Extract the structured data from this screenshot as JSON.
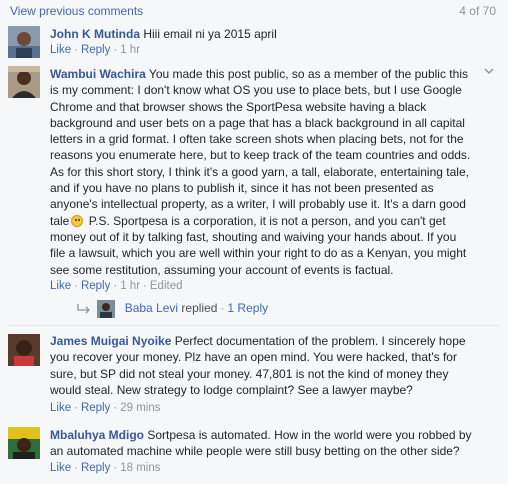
{
  "header": {
    "view_previous": "View previous comments",
    "count": "4 of 70"
  },
  "comments": [
    {
      "author": "John K Mutinda",
      "text": "Hiii email ni ya 2015 april",
      "like": "Like",
      "reply": "Reply",
      "time": "1 hr"
    },
    {
      "author": "Wambui Wachira",
      "lines": [
        " You made this post public, so as a member of the public this",
        "is my comment: I don't know what OS you use to place bets, but I use Google",
        "Chrome and that browser shows the SportPesa website having a black",
        "background and user bets on a page that has a black background in all capital",
        "letters in a grid format. I often take screen shots when placing bets, not for the",
        "reasons you enumerate here, but to keep track of the team countries and odds.",
        "As for this short story, I think it's a good yarn, a tall, elaborate, entertaining tale,",
        "and if you have no plans to publish it, since it has not been presented as",
        "anyone's intellectual property, as a writer, I will probably use it. It's a darn good",
        "tale",
        " P.S. Sportpesa is a corporation, it is not a person, and you can't get",
        "money out of it by talking fast, shouting and waiving your hands about. If you",
        "file a lawsuit, which you are well within your right to do as a Kenyan, you might",
        "see some restitution, assuming your account of events is factual."
      ],
      "like": "Like",
      "reply": "Reply",
      "time": "1 hr",
      "edited": "Edited",
      "reply_summary": {
        "name": "Baba Levi",
        "text": " replied",
        "count": "1 Reply"
      }
    },
    {
      "author": "James Muigai Nyoike",
      "lines": [
        " Perfect documentation of the problem. I sincerely hope",
        "you recover your money. Plz have an open mind. You were hacked, that's for",
        "sure, but SP did not steal your money. 47,801 is not the kind of money they",
        "would steal. New strategy to lodge complaint? See a lawyer maybe?"
      ],
      "like": "Like",
      "reply": "Reply",
      "time": "29 mins"
    },
    {
      "author": "Mbaluhya Mdigo",
      "lines": [
        " Sortpesa is automated. How in the world were you robbed by",
        "an automated machine while people were still busy betting on the other side?"
      ],
      "like": "Like",
      "reply": "Reply",
      "time": "18 mins"
    }
  ],
  "colors": {
    "background": "#f6f7f9",
    "link": "#4267b2",
    "name": "#365899",
    "meta": "#90949c"
  }
}
